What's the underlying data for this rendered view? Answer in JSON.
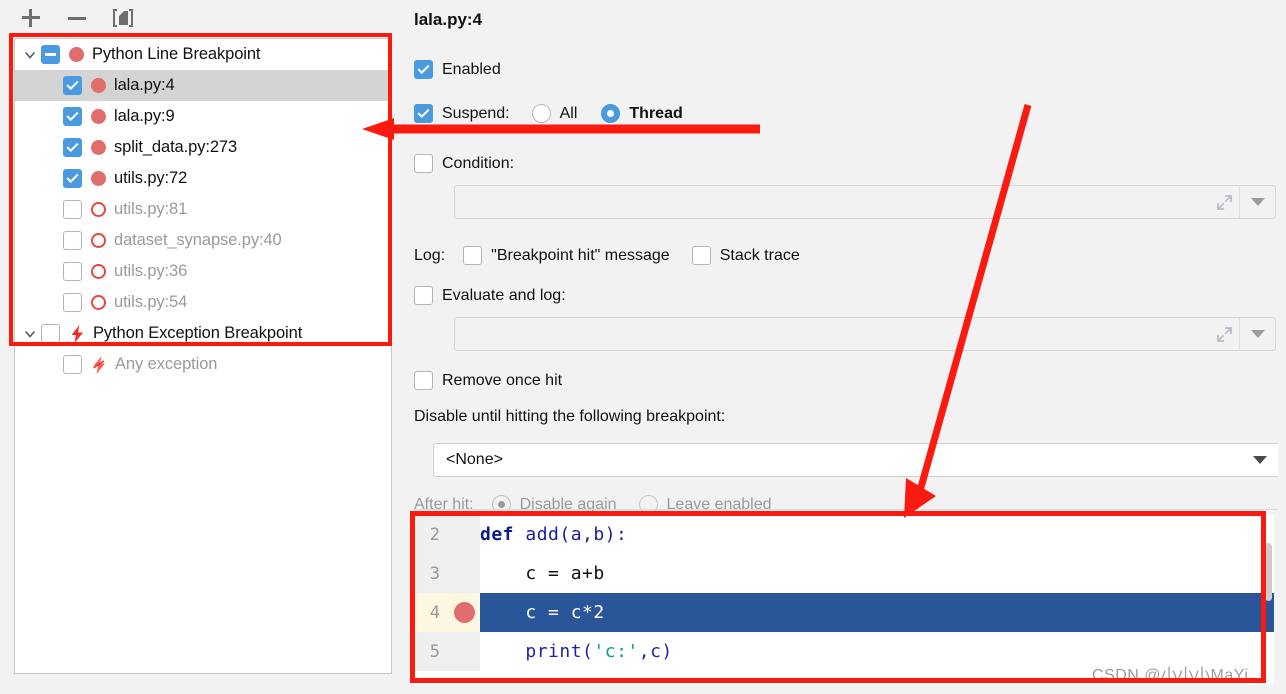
{
  "toolbar": {
    "add_label": "+",
    "remove_label": "−",
    "view_label": "[doc]",
    "icons": [
      "plus-icon",
      "minus-icon",
      "view-breakpoints-icon"
    ]
  },
  "breakpoint_tree": {
    "groups": [
      {
        "label": "Python Line Breakpoint",
        "checkbox": "partial",
        "expanded": true,
        "icon": "red-dot-filled",
        "children": [
          {
            "label": "lala.py:4",
            "checked": true,
            "icon": "red-dot-filled",
            "selected": true,
            "muted": false
          },
          {
            "label": "lala.py:9",
            "checked": true,
            "icon": "red-dot-filled",
            "selected": false,
            "muted": false
          },
          {
            "label": "split_data.py:273",
            "checked": true,
            "icon": "red-dot-filled",
            "selected": false,
            "muted": false
          },
          {
            "label": "utils.py:72",
            "checked": true,
            "icon": "red-dot-filled",
            "selected": false,
            "muted": false
          },
          {
            "label": "utils.py:81",
            "checked": false,
            "icon": "red-dot-hollow",
            "selected": false,
            "muted": true
          },
          {
            "label": "dataset_synapse.py:40",
            "checked": false,
            "icon": "red-dot-hollow",
            "selected": false,
            "muted": true
          },
          {
            "label": "utils.py:36",
            "checked": false,
            "icon": "red-dot-hollow",
            "selected": false,
            "muted": true
          },
          {
            "label": "utils.py:54",
            "checked": false,
            "icon": "red-dot-hollow",
            "selected": false,
            "muted": true
          }
        ]
      },
      {
        "label": "Python Exception Breakpoint",
        "checkbox": "unchecked",
        "expanded": true,
        "icon": "lightning-icon",
        "children": [
          {
            "label": "Any exception",
            "checked": false,
            "icon": "lightning-icon",
            "selected": false,
            "muted": true
          }
        ]
      }
    ]
  },
  "details": {
    "title": "lala.py:4",
    "enabled": {
      "label": "Enabled",
      "checked": true
    },
    "suspend": {
      "label": "Suspend:",
      "checked": true,
      "options": [
        {
          "label": "All",
          "selected": false
        },
        {
          "label": "Thread",
          "selected": true
        }
      ]
    },
    "condition": {
      "label": "Condition:",
      "checked": false,
      "value": ""
    },
    "log": {
      "label": "Log:",
      "message_option": {
        "label": "\"Breakpoint hit\" message",
        "checked": false
      },
      "stack_option": {
        "label": "Stack trace",
        "checked": false
      }
    },
    "evaluate_and_log": {
      "label": "Evaluate and log:",
      "checked": false,
      "value": ""
    },
    "remove_once_hit": {
      "label": "Remove once hit",
      "checked": false
    },
    "disable_until": {
      "label": "Disable until hitting the following breakpoint:",
      "selected_value": "<None>"
    },
    "after_hit": {
      "label": "After hit:",
      "options": [
        {
          "label": "Disable again",
          "selected": true
        },
        {
          "label": "Leave enabled",
          "selected": false
        }
      ]
    }
  },
  "code_preview": {
    "lines": [
      {
        "number": "2",
        "breakpoint": false,
        "highlighted": false,
        "tokens": [
          {
            "t": "def ",
            "c": "kw"
          },
          {
            "t": "add(a,b):",
            "c": "fn"
          }
        ]
      },
      {
        "number": "3",
        "breakpoint": false,
        "highlighted": false,
        "tokens": [
          {
            "t": "    c = a+b",
            "c": "plain"
          }
        ]
      },
      {
        "number": "4",
        "breakpoint": true,
        "highlighted": true,
        "tokens": [
          {
            "t": "    c = c*2",
            "c": "plain"
          }
        ]
      },
      {
        "number": "5",
        "breakpoint": false,
        "highlighted": false,
        "tokens": [
          {
            "t": "    ",
            "c": "plain"
          },
          {
            "t": "print",
            "c": "pblue"
          },
          {
            "t": "(",
            "c": "pblue"
          },
          {
            "t": "'c:'",
            "c": "str"
          },
          {
            "t": ",c)",
            "c": "pblue"
          }
        ]
      }
    ]
  },
  "watermark": {
    "text": "CSDN @小小小MaYi"
  },
  "colors": {
    "accent_blue": "#4a9ae0",
    "breakpoint_red": "#e06c6c",
    "annotation_red": "#fb1a10",
    "selection_blue": "#2a5699",
    "panel_bg": "#f2f2f2"
  }
}
